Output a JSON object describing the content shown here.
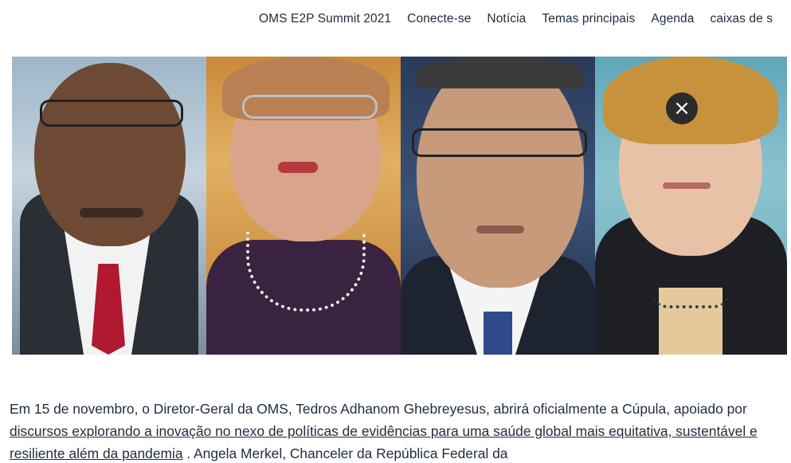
{
  "nav": {
    "items": [
      {
        "label": "OMS E2P Summit 2021"
      },
      {
        "label": "Conecte-se"
      },
      {
        "label": "Notícia"
      },
      {
        "label": "Temas principais"
      },
      {
        "label": "Agenda"
      },
      {
        "label": "caixas de s"
      }
    ]
  },
  "hero": {
    "close_icon": "×"
  },
  "article": {
    "text_before": "Em 15 de novembro, o Diretor-Geral da OMS, Tedros Adhanom Ghebreyesus, abrirá oficialmente a Cúpula, apoiado por ",
    "link_text": "discursos explorando a inovação no nexo de políticas de evidências para uma saúde global mais equitativa, sustentável e resiliente além da pandemia",
    "text_after": " . Angela Merkel, Chanceler da República Federal da"
  },
  "colors": {
    "text": "#1f2d3d",
    "close_button_bg": "#2b2b2b"
  }
}
